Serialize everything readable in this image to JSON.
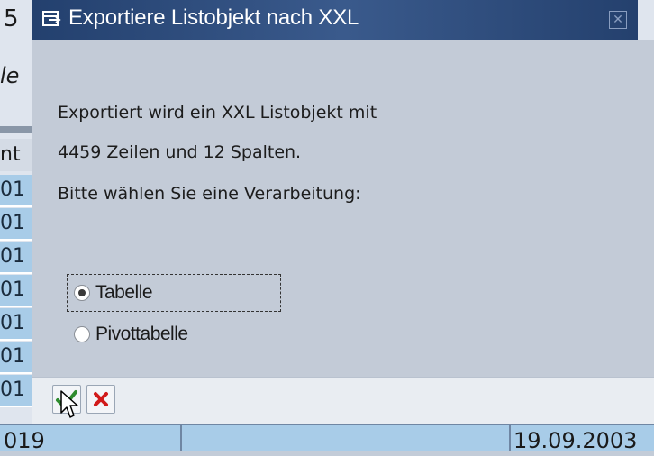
{
  "background": {
    "top_fragment": "5",
    "italic_fragment": "le",
    "header_fragment": "nt",
    "row_fragments": [
      "01",
      "01",
      "01",
      "01",
      "01",
      "01",
      "01"
    ],
    "bottom_left": "019",
    "bottom_date": "19.09.2003"
  },
  "dialog": {
    "title": "Exportiere Listobjekt nach XXL",
    "message_lines": [
      "Exportiert wird ein XXL Listobjekt mit",
      "4459 Zeilen und 12 Spalten.",
      "Bitte wählen Sie eine Verarbeitung:"
    ],
    "options": [
      {
        "label": "Tabelle",
        "checked": true
      },
      {
        "label": "Pivottabelle",
        "checked": false
      }
    ],
    "buttons": {
      "confirm_icon": "checkmark-icon",
      "cancel_icon": "cancel-x-icon"
    }
  },
  "colors": {
    "title_bar": "#2c4a7c",
    "confirm": "#2e8b2e",
    "cancel": "#d11a1a"
  }
}
